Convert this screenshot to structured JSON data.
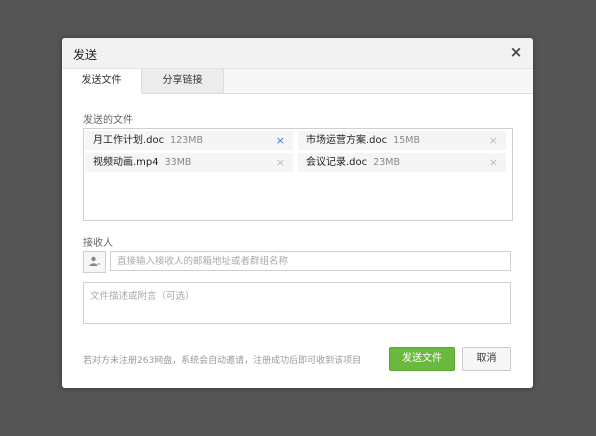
{
  "dialog": {
    "title": "发送",
    "close_glyph": "×",
    "tabs": [
      {
        "label": "发送文件",
        "active": true
      },
      {
        "label": "分享链接",
        "active": false
      }
    ]
  },
  "files_section": {
    "label": "发送的文件",
    "items": [
      {
        "name": "月工作计划.doc",
        "size": "123MB"
      },
      {
        "name": "市场运营方案.doc",
        "size": "15MB"
      },
      {
        "name": "视频动画.mp4",
        "size": "33MB"
      },
      {
        "name": "会议记录.doc",
        "size": "23MB"
      }
    ],
    "remove_glyph": "×"
  },
  "recipient": {
    "label": "接收人",
    "placeholder": "直接输入接收人的邮箱地址或者群组名称",
    "value": "",
    "contact_icon": "person-icon"
  },
  "description": {
    "placeholder": "文件描述或附言（可选）",
    "value": ""
  },
  "footer": {
    "hint": "若对方未注册263网盘，系统会自动邀请，注册成功后即可收到该项目",
    "send_label": "发送文件",
    "cancel_label": "取消"
  },
  "colors": {
    "accent_green": "#6ab93f",
    "link_blue": "#3a7bd5",
    "backdrop": "#555555"
  }
}
